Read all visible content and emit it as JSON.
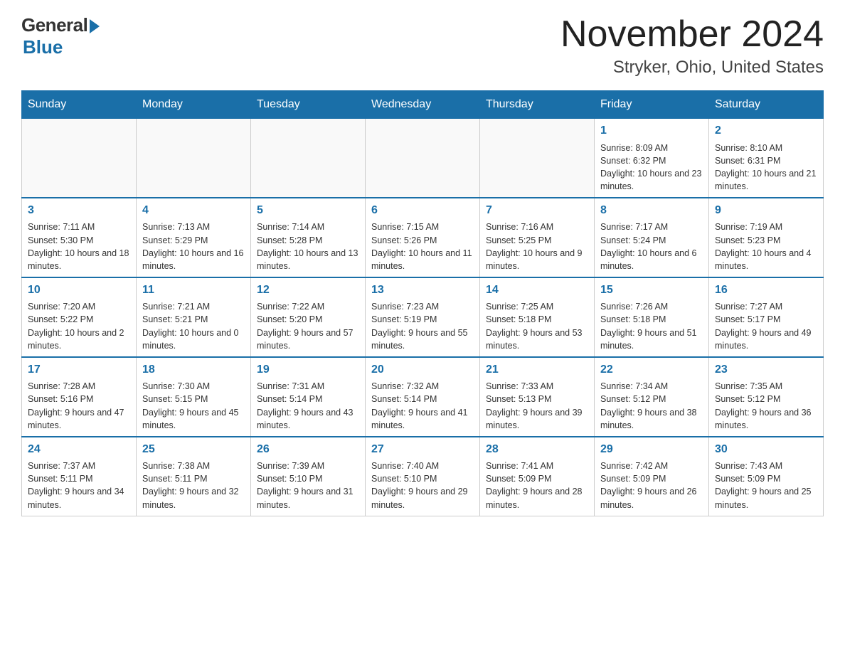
{
  "header": {
    "logo_general": "General",
    "logo_blue": "Blue",
    "title": "November 2024",
    "location": "Stryker, Ohio, United States"
  },
  "days_of_week": [
    "Sunday",
    "Monday",
    "Tuesday",
    "Wednesday",
    "Thursday",
    "Friday",
    "Saturday"
  ],
  "weeks": [
    [
      {
        "day": "",
        "info": ""
      },
      {
        "day": "",
        "info": ""
      },
      {
        "day": "",
        "info": ""
      },
      {
        "day": "",
        "info": ""
      },
      {
        "day": "",
        "info": ""
      },
      {
        "day": "1",
        "info": "Sunrise: 8:09 AM\nSunset: 6:32 PM\nDaylight: 10 hours and 23 minutes."
      },
      {
        "day": "2",
        "info": "Sunrise: 8:10 AM\nSunset: 6:31 PM\nDaylight: 10 hours and 21 minutes."
      }
    ],
    [
      {
        "day": "3",
        "info": "Sunrise: 7:11 AM\nSunset: 5:30 PM\nDaylight: 10 hours and 18 minutes."
      },
      {
        "day": "4",
        "info": "Sunrise: 7:13 AM\nSunset: 5:29 PM\nDaylight: 10 hours and 16 minutes."
      },
      {
        "day": "5",
        "info": "Sunrise: 7:14 AM\nSunset: 5:28 PM\nDaylight: 10 hours and 13 minutes."
      },
      {
        "day": "6",
        "info": "Sunrise: 7:15 AM\nSunset: 5:26 PM\nDaylight: 10 hours and 11 minutes."
      },
      {
        "day": "7",
        "info": "Sunrise: 7:16 AM\nSunset: 5:25 PM\nDaylight: 10 hours and 9 minutes."
      },
      {
        "day": "8",
        "info": "Sunrise: 7:17 AM\nSunset: 5:24 PM\nDaylight: 10 hours and 6 minutes."
      },
      {
        "day": "9",
        "info": "Sunrise: 7:19 AM\nSunset: 5:23 PM\nDaylight: 10 hours and 4 minutes."
      }
    ],
    [
      {
        "day": "10",
        "info": "Sunrise: 7:20 AM\nSunset: 5:22 PM\nDaylight: 10 hours and 2 minutes."
      },
      {
        "day": "11",
        "info": "Sunrise: 7:21 AM\nSunset: 5:21 PM\nDaylight: 10 hours and 0 minutes."
      },
      {
        "day": "12",
        "info": "Sunrise: 7:22 AM\nSunset: 5:20 PM\nDaylight: 9 hours and 57 minutes."
      },
      {
        "day": "13",
        "info": "Sunrise: 7:23 AM\nSunset: 5:19 PM\nDaylight: 9 hours and 55 minutes."
      },
      {
        "day": "14",
        "info": "Sunrise: 7:25 AM\nSunset: 5:18 PM\nDaylight: 9 hours and 53 minutes."
      },
      {
        "day": "15",
        "info": "Sunrise: 7:26 AM\nSunset: 5:18 PM\nDaylight: 9 hours and 51 minutes."
      },
      {
        "day": "16",
        "info": "Sunrise: 7:27 AM\nSunset: 5:17 PM\nDaylight: 9 hours and 49 minutes."
      }
    ],
    [
      {
        "day": "17",
        "info": "Sunrise: 7:28 AM\nSunset: 5:16 PM\nDaylight: 9 hours and 47 minutes."
      },
      {
        "day": "18",
        "info": "Sunrise: 7:30 AM\nSunset: 5:15 PM\nDaylight: 9 hours and 45 minutes."
      },
      {
        "day": "19",
        "info": "Sunrise: 7:31 AM\nSunset: 5:14 PM\nDaylight: 9 hours and 43 minutes."
      },
      {
        "day": "20",
        "info": "Sunrise: 7:32 AM\nSunset: 5:14 PM\nDaylight: 9 hours and 41 minutes."
      },
      {
        "day": "21",
        "info": "Sunrise: 7:33 AM\nSunset: 5:13 PM\nDaylight: 9 hours and 39 minutes."
      },
      {
        "day": "22",
        "info": "Sunrise: 7:34 AM\nSunset: 5:12 PM\nDaylight: 9 hours and 38 minutes."
      },
      {
        "day": "23",
        "info": "Sunrise: 7:35 AM\nSunset: 5:12 PM\nDaylight: 9 hours and 36 minutes."
      }
    ],
    [
      {
        "day": "24",
        "info": "Sunrise: 7:37 AM\nSunset: 5:11 PM\nDaylight: 9 hours and 34 minutes."
      },
      {
        "day": "25",
        "info": "Sunrise: 7:38 AM\nSunset: 5:11 PM\nDaylight: 9 hours and 32 minutes."
      },
      {
        "day": "26",
        "info": "Sunrise: 7:39 AM\nSunset: 5:10 PM\nDaylight: 9 hours and 31 minutes."
      },
      {
        "day": "27",
        "info": "Sunrise: 7:40 AM\nSunset: 5:10 PM\nDaylight: 9 hours and 29 minutes."
      },
      {
        "day": "28",
        "info": "Sunrise: 7:41 AM\nSunset: 5:09 PM\nDaylight: 9 hours and 28 minutes."
      },
      {
        "day": "29",
        "info": "Sunrise: 7:42 AM\nSunset: 5:09 PM\nDaylight: 9 hours and 26 minutes."
      },
      {
        "day": "30",
        "info": "Sunrise: 7:43 AM\nSunset: 5:09 PM\nDaylight: 9 hours and 25 minutes."
      }
    ]
  ]
}
